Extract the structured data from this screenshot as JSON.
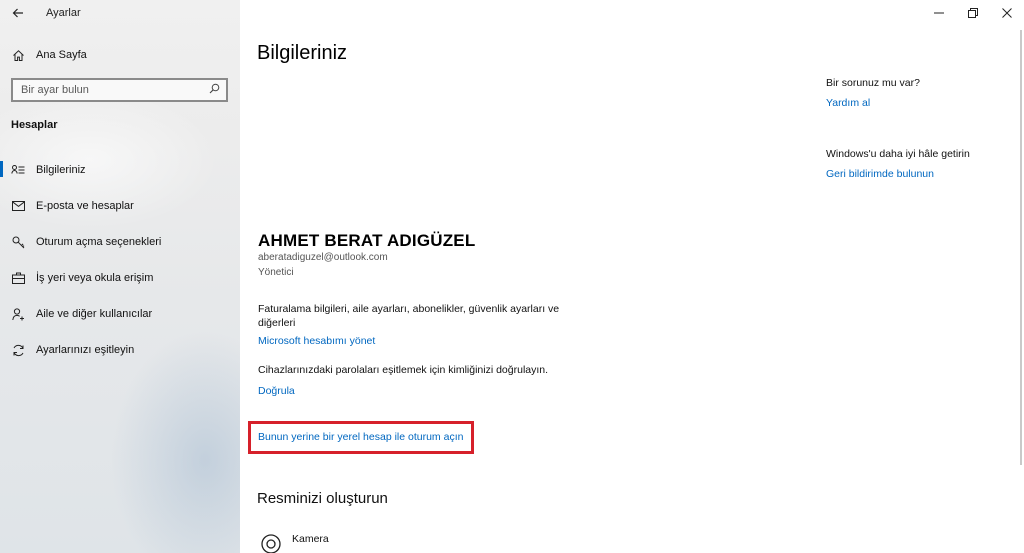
{
  "window": {
    "title": "Ayarlar",
    "controls": {
      "minimize": "—",
      "restore": "❐",
      "close": "✕"
    }
  },
  "sidebar": {
    "home_label": "Ana Sayfa",
    "search_placeholder": "Bir ayar bulun",
    "section_header": "Hesaplar",
    "items": [
      {
        "label": "Bilgileriniz",
        "icon": "user-info-icon",
        "selected": true
      },
      {
        "label": "E-posta ve hesaplar",
        "icon": "mail-icon",
        "selected": false
      },
      {
        "label": "Oturum açma seçenekleri",
        "icon": "key-icon",
        "selected": false
      },
      {
        "label": "İş yeri veya okula erişim",
        "icon": "briefcase-icon",
        "selected": false
      },
      {
        "label": "Aile ve diğer kullanıcılar",
        "icon": "person-add-icon",
        "selected": false
      },
      {
        "label": "Ayarlarınızı eşitleyin",
        "icon": "sync-icon",
        "selected": false
      }
    ]
  },
  "main": {
    "page_title": "Bilgileriniz",
    "user": {
      "name": "AHMET BERAT ADIGÜZEL",
      "email": "aberatadiguzel@outlook.com",
      "role": "Yönetici"
    },
    "billing_desc": "Faturalama bilgileri, aile ayarları, abonelikler, güvenlik ayarları ve diğerleri",
    "manage_link": "Microsoft hesabımı yönet",
    "verify_desc": "Cihazlarınızdaki parolaları eşitlemek için kimliğinizi doğrulayın.",
    "verify_link": "Doğrula",
    "local_account_link": "Bunun yerine bir yerel hesap ile oturum açın",
    "picture_section": "Resminizi oluşturun",
    "camera_label": "Kamera"
  },
  "side_panel": {
    "help_question": "Bir sorunuz mu var?",
    "help_link": "Yardım al",
    "improve_text": "Windows'u daha iyi hâle getirin",
    "feedback_link": "Geri bildirimde bulunun"
  },
  "colors": {
    "accent": "#0067c0",
    "highlight": "#d6202a"
  }
}
